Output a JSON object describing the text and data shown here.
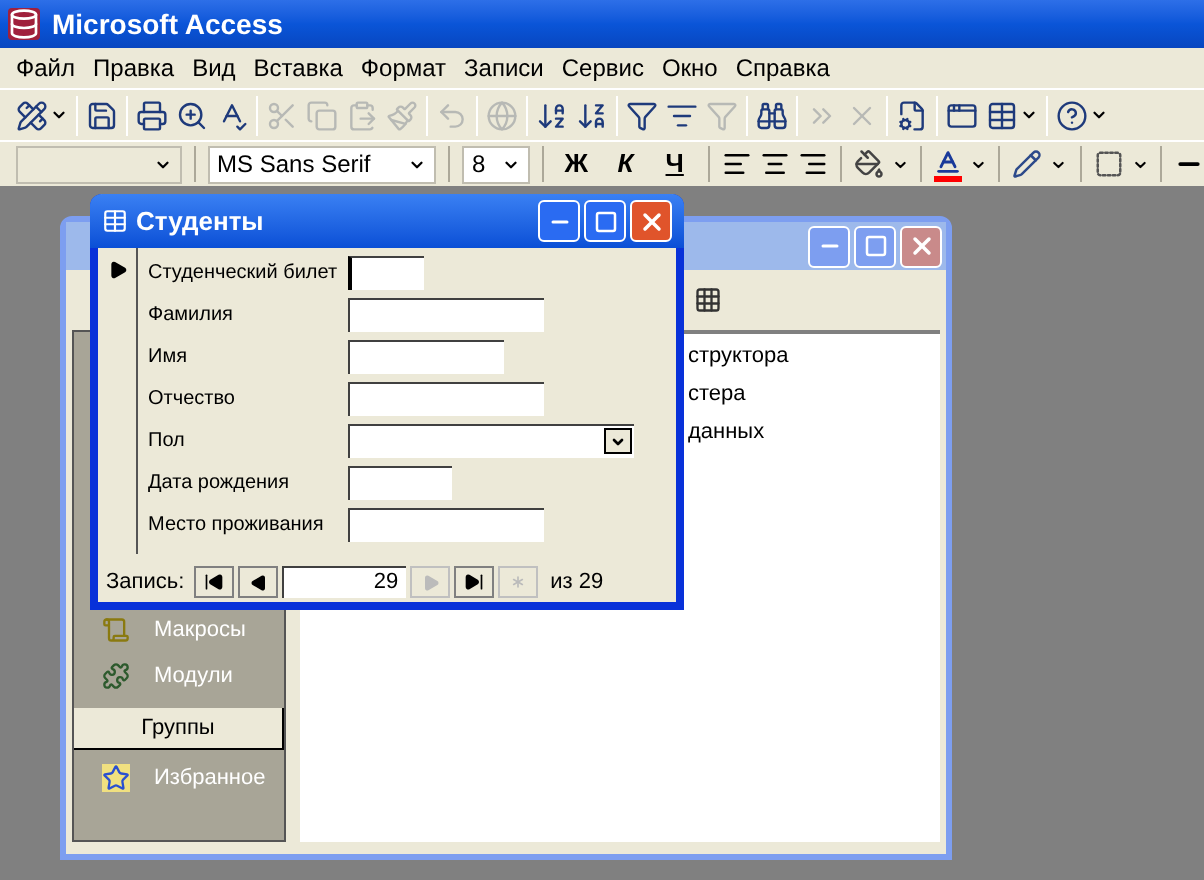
{
  "app": {
    "title": "Microsoft Access"
  },
  "menu": [
    "Файл",
    "Правка",
    "Вид",
    "Вставка",
    "Формат",
    "Записи",
    "Сервис",
    "Окно",
    "Справка"
  ],
  "toolbar": [
    [
      {
        "kind": "design",
        "disabled": false
      }
    ],
    [
      {
        "kind": "save",
        "disabled": false
      }
    ],
    [
      {
        "kind": "print",
        "disabled": false
      },
      {
        "kind": "preview",
        "disabled": false
      },
      {
        "kind": "spell",
        "disabled": false
      }
    ],
    [
      {
        "kind": "cut",
        "disabled": true
      },
      {
        "kind": "copy",
        "disabled": true
      },
      {
        "kind": "paste",
        "disabled": true
      },
      {
        "kind": "painter",
        "disabled": true
      }
    ],
    [
      {
        "kind": "undo",
        "disabled": true
      }
    ],
    [
      {
        "kind": "hyperlink",
        "disabled": true
      }
    ],
    [
      {
        "kind": "sort_asc",
        "disabled": false
      },
      {
        "kind": "sort_desc",
        "disabled": false
      }
    ],
    [
      {
        "kind": "filter_selection",
        "disabled": false
      },
      {
        "kind": "filter_form",
        "disabled": false
      },
      {
        "kind": "apply_filter",
        "disabled": true
      }
    ],
    [
      {
        "kind": "find",
        "disabled": false
      }
    ],
    [
      {
        "kind": "new_record",
        "disabled": true
      },
      {
        "kind": "delete_record",
        "disabled": true
      }
    ],
    [
      {
        "kind": "properties",
        "disabled": false
      }
    ],
    [
      {
        "kind": "database_window",
        "disabled": false
      },
      {
        "kind": "new_object",
        "disabled": false
      }
    ],
    [
      {
        "kind": "help",
        "disabled": false
      }
    ]
  ],
  "format_toolbar": {
    "font": "MS Sans Serif",
    "size": "8",
    "bold": "Ж",
    "italic": "К",
    "underline": "Ч"
  },
  "database_window": {
    "list_items": [
      "структора",
      "стера",
      "данных"
    ],
    "objects": [
      {
        "label": "Макросы",
        "kind": "macro"
      },
      {
        "label": "Модули",
        "kind": "module"
      }
    ],
    "groups_button": "Группы",
    "groups": [
      {
        "label": "Избранное"
      }
    ]
  },
  "form": {
    "title": "Студенты",
    "fields": [
      {
        "label": "Студенческий билет",
        "kind": "text"
      },
      {
        "label": "Фамилия",
        "kind": "text"
      },
      {
        "label": "Имя",
        "kind": "text"
      },
      {
        "label": "Отчество",
        "kind": "text"
      },
      {
        "label": "Пол",
        "kind": "combo"
      },
      {
        "label": "Дата рождения",
        "kind": "text"
      },
      {
        "label": "Место проживания",
        "kind": "text"
      }
    ],
    "navigation": {
      "label": "Запись:",
      "current": "29",
      "total": "из 29"
    }
  }
}
